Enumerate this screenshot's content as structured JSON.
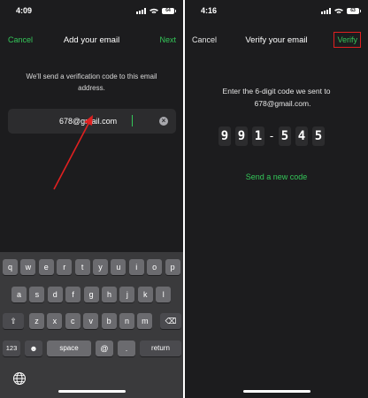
{
  "left_screen": {
    "status": {
      "time": "4:09",
      "battery": "64"
    },
    "nav": {
      "cancel": "Cancel",
      "title": "Add your email",
      "next": "Next"
    },
    "description": "We'll send a verification code to this email address.",
    "email_field": {
      "value": "678@gmail.com",
      "clear_icon": "clear-icon"
    },
    "keyboard": {
      "row1": [
        "q",
        "w",
        "e",
        "r",
        "t",
        "y",
        "u",
        "i",
        "o",
        "p"
      ],
      "row2": [
        "a",
        "s",
        "d",
        "f",
        "g",
        "h",
        "j",
        "k",
        "l"
      ],
      "row3": [
        "z",
        "x",
        "c",
        "v",
        "b",
        "n",
        "m"
      ],
      "row4": {
        "numbers": "123",
        "space": "space",
        "at": "@",
        "dot": ".",
        "return": "return"
      }
    }
  },
  "right_screen": {
    "status": {
      "time": "4:16",
      "battery": "63"
    },
    "nav": {
      "cancel": "Cancel",
      "title": "Verify your email",
      "verify": "Verify"
    },
    "instruction_line1": "Enter the 6-digit code we sent to",
    "instruction_line2": "678@gmail.com.",
    "code": [
      "9",
      "9",
      "1",
      "5",
      "4",
      "5"
    ],
    "code_separator": "-",
    "resend": "Send a new code"
  },
  "colors": {
    "accent": "#34c759",
    "highlight": "#e02020",
    "background": "#1c1c1e"
  }
}
